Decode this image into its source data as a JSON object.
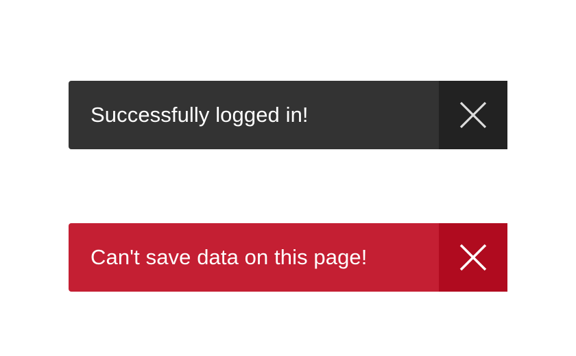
{
  "toasts": [
    {
      "variant": "success",
      "message": "Successfully logged in!",
      "close_icon": "close-icon",
      "colors": {
        "body": "#333333",
        "close": "#222222",
        "icon": "#dddddd"
      }
    },
    {
      "variant": "error",
      "message": "Can't save data on this page!",
      "close_icon": "close-icon",
      "colors": {
        "body": "#c41f33",
        "close": "#b00b1f",
        "icon": "#ffffff"
      }
    }
  ]
}
